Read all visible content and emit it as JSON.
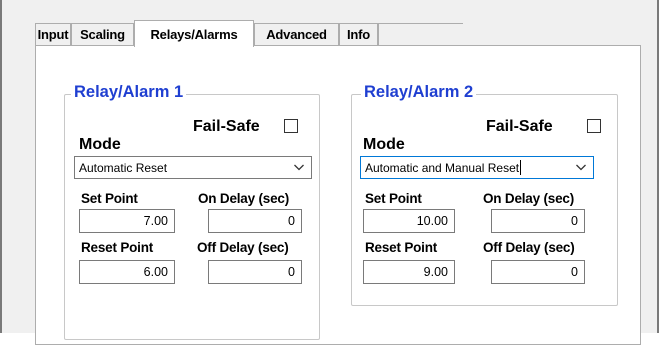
{
  "tabs": [
    {
      "label": "Input"
    },
    {
      "label": "Scaling"
    },
    {
      "label": "Relays/Alarms"
    },
    {
      "label": "Advanced"
    },
    {
      "label": "Info"
    }
  ],
  "active_tab": "Relays/Alarms",
  "relay1": {
    "title": "Relay/Alarm 1",
    "fail_safe_label": "Fail-Safe",
    "fail_safe_checked": false,
    "mode_label": "Mode",
    "mode_value": "Automatic Reset",
    "set_point_label": "Set Point",
    "set_point_value": "7.00",
    "on_delay_label": "On Delay (sec)",
    "on_delay_value": "0",
    "reset_point_label": "Reset Point",
    "reset_point_value": "6.00",
    "off_delay_label": "Off Delay (sec)",
    "off_delay_value": "0"
  },
  "relay2": {
    "title": "Relay/Alarm 2",
    "fail_safe_label": "Fail-Safe",
    "fail_safe_checked": false,
    "mode_label": "Mode",
    "mode_value": "Automatic and Manual Reset",
    "set_point_label": "Set Point",
    "set_point_value": "10.00",
    "on_delay_label": "On Delay (sec)",
    "on_delay_value": "0",
    "reset_point_label": "Reset Point",
    "reset_point_value": "9.00",
    "off_delay_label": "Off Delay (sec)",
    "off_delay_value": "0"
  },
  "colors": {
    "group_title": "#1f3fd1",
    "focus_border": "#0078d7",
    "window_bg": "#f0f0f0"
  }
}
